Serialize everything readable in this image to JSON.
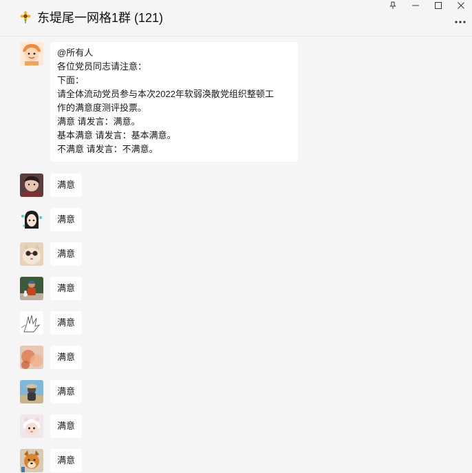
{
  "window": {
    "title": "东堤尾一网格1群 (121)",
    "title_icon": "sunflower-icon",
    "controls": [
      "pin-icon",
      "minimize-icon",
      "maximize-icon",
      "close-icon"
    ],
    "more_icon": "more-icon"
  },
  "messages": [
    {
      "avatar": "cartoon-avatar",
      "lines": [
        "@所有人",
        "各位党员同志请注意：",
        "下面：",
        "请全体流动党员参与本次2022年软弱涣散党组织整顿工",
        "作的满意度测评投票。",
        "满意 请发言：满意。",
        "基本满意 请发言：基本满意。",
        "不满意 请发言：不满意。"
      ]
    },
    {
      "avatar": "child-photo-avatar",
      "text": "满意"
    },
    {
      "avatar": "anime-girl-avatar",
      "text": "满意"
    },
    {
      "avatar": "cat-sunglasses-avatar",
      "text": "满意"
    },
    {
      "avatar": "figure-photo-avatar",
      "text": "满意"
    },
    {
      "avatar": "hand-sketch-avatar",
      "text": "满意"
    },
    {
      "avatar": "blurred-photo-avatar",
      "text": "满意"
    },
    {
      "avatar": "outdoor-photo-avatar",
      "text": "满意"
    },
    {
      "avatar": "baby-photo-avatar",
      "text": "满意"
    },
    {
      "avatar": "dog-photo-avatar",
      "text": "满意"
    }
  ]
}
